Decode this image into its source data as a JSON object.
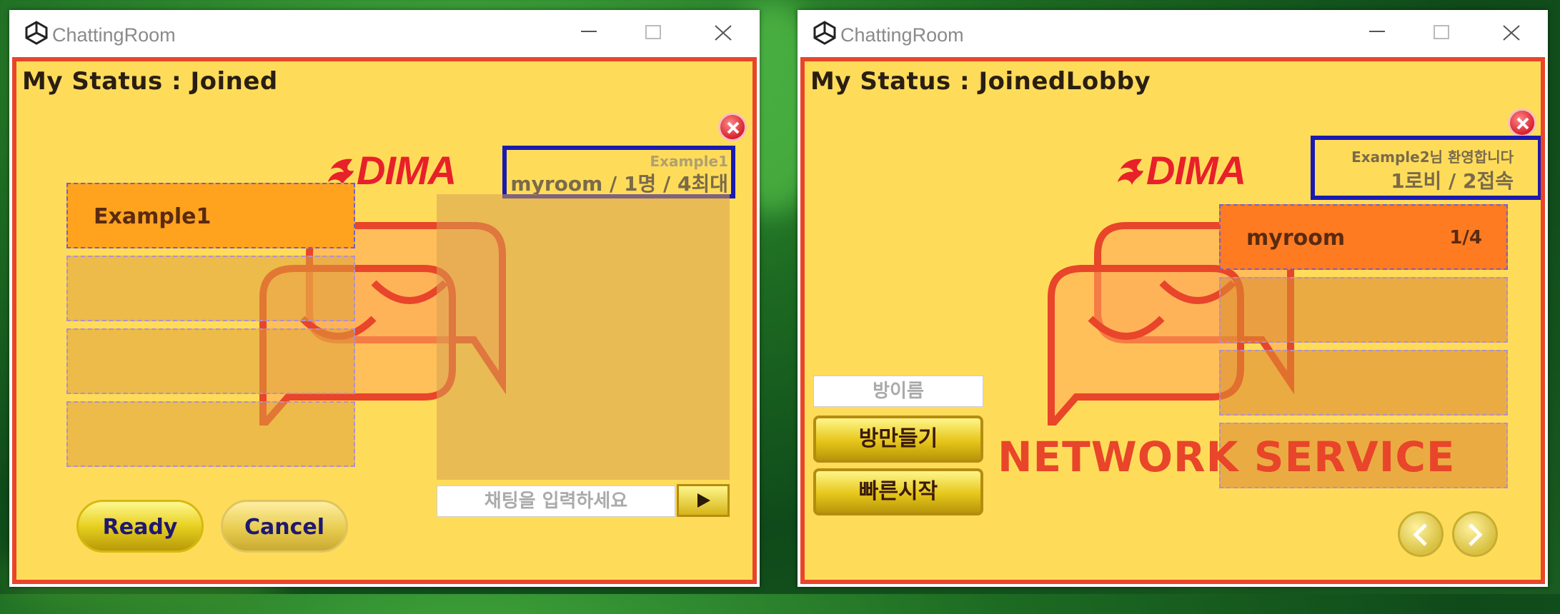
{
  "windows": [
    {
      "title": "ChattingRoom",
      "status": "My Status : Joined",
      "info_line1": "Example1",
      "info_line2": "myroom / 1명 / 4최대",
      "players": [
        "Example1",
        "",
        "",
        ""
      ],
      "chat_placeholder": "채팅을 입력하세요",
      "ready_label": "Ready",
      "cancel_label": "Cancel",
      "logo_text": "DIMA"
    },
    {
      "title": "ChattingRoom",
      "status": "My Status : JoinedLobby",
      "info_line1": "Example2님 환영합니다",
      "info_line2": "1로비 / 2접속",
      "rooms": [
        {
          "name": "myroom",
          "count": "1/4"
        },
        {
          "name": "",
          "count": ""
        },
        {
          "name": "",
          "count": ""
        },
        {
          "name": "",
          "count": ""
        }
      ],
      "room_name_placeholder": "방이름",
      "create_room_label": "방만들기",
      "quick_start_label": "빠른시작",
      "network_service": "NETWORK SERVICE",
      "logo_text": "DIMA"
    }
  ],
  "colors": {
    "game_bg": "#fedc5a",
    "border": "#e8452a",
    "info_border": "#1a1ab0",
    "active_slot": "#ffa31f",
    "room_slot": "#ff7b22"
  }
}
